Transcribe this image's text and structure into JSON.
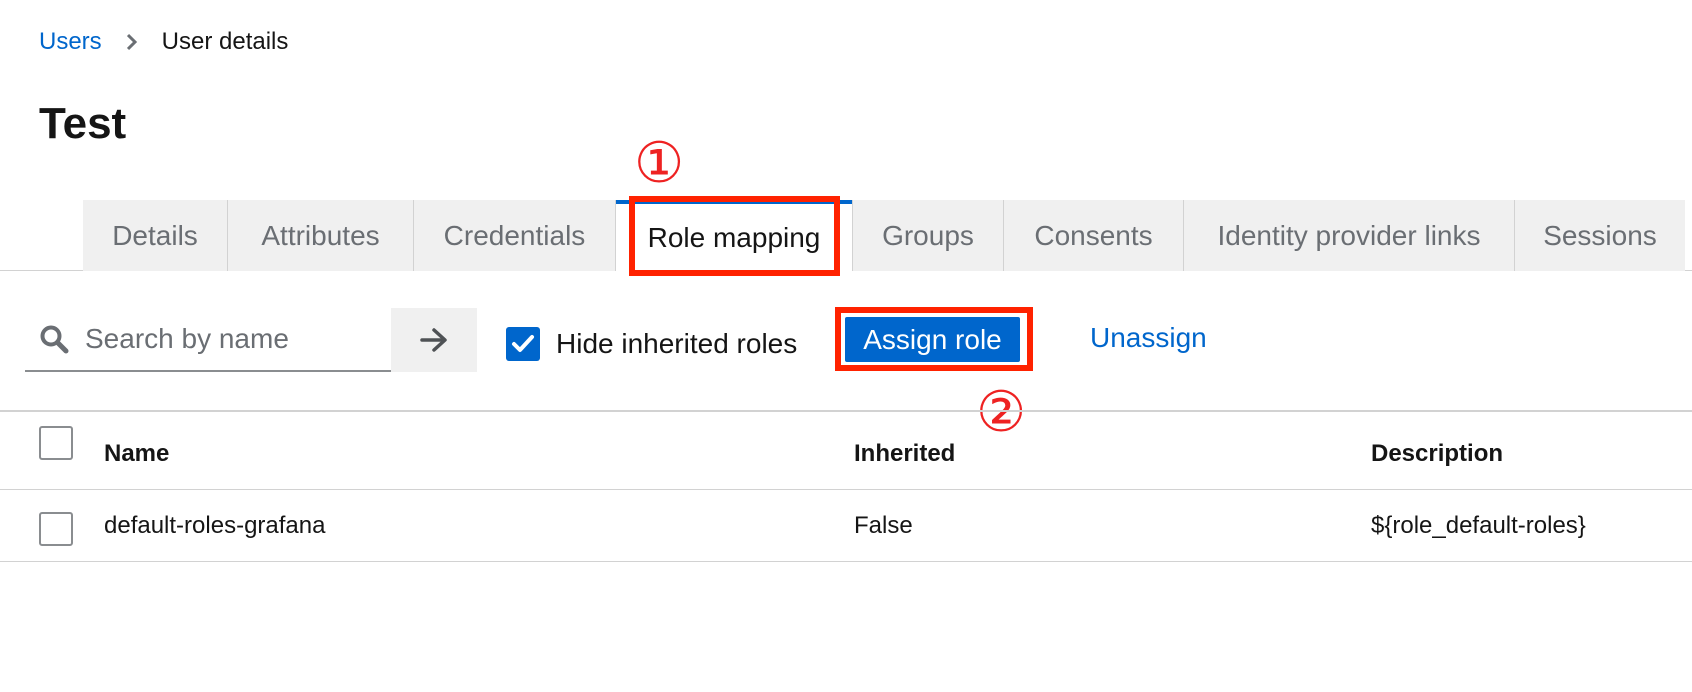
{
  "breadcrumb": {
    "parent": "Users",
    "current": "User details"
  },
  "page": {
    "title": "Test"
  },
  "annotations": {
    "step1": "①",
    "step2": "②"
  },
  "tabs": [
    {
      "label": "Details"
    },
    {
      "label": "Attributes"
    },
    {
      "label": "Credentials"
    },
    {
      "label": "Role mapping",
      "active": true
    },
    {
      "label": "Groups"
    },
    {
      "label": "Consents"
    },
    {
      "label": "Identity provider links"
    },
    {
      "label": "Sessions"
    }
  ],
  "toolbar": {
    "search_placeholder": "Search by name",
    "hide_inherited_label": "Hide inherited roles",
    "hide_inherited_checked": true,
    "assign_label": "Assign role",
    "unassign_label": "Unassign"
  },
  "table": {
    "columns": [
      "Name",
      "Inherited",
      "Description"
    ],
    "rows": [
      {
        "name": "default-roles-grafana",
        "inherited": "False",
        "description": "${role_default-roles}"
      }
    ]
  },
  "colors": {
    "accent": "#0066cc",
    "annotation": "#ff2200"
  },
  "icons": {
    "breadcrumb_separator": "chevron-right-icon",
    "search": "search-icon",
    "search_go": "arrow-right-icon",
    "checkbox": "checkmark-icon"
  }
}
